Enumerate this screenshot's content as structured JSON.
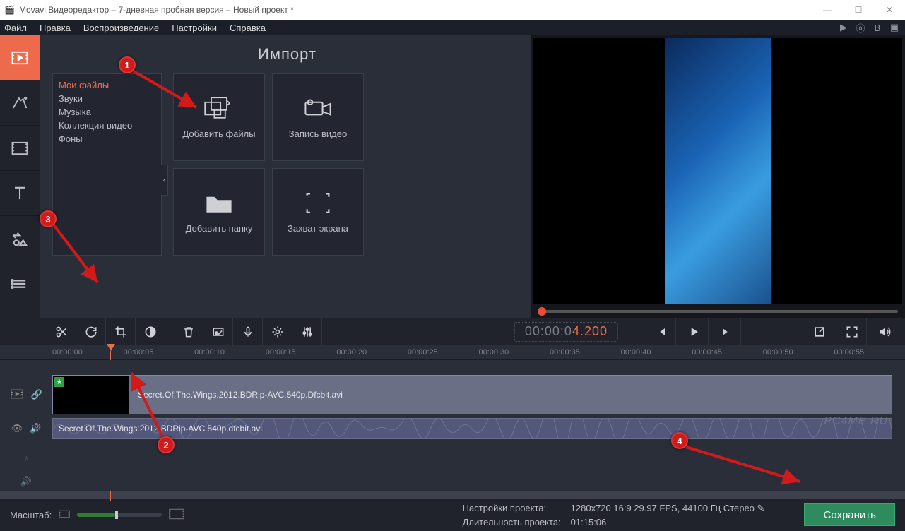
{
  "window": {
    "title": "Movavi Видеоредактор – 7-дневная пробная версия – Новый проект *"
  },
  "menu": {
    "items": [
      "Файл",
      "Правка",
      "Воспроизведение",
      "Настройки",
      "Справка"
    ]
  },
  "import": {
    "title": "Импорт",
    "sources": [
      "Мои файлы",
      "Звуки",
      "Музыка",
      "Коллекция видео",
      "Фоны"
    ],
    "tiles": {
      "add_files": "Добавить файлы",
      "record_video": "Запись видео",
      "add_folder": "Добавить папку",
      "screen_capture": "Захват экрана"
    }
  },
  "playback": {
    "timecode_grey": "00:00:0",
    "timecode_orange": "4.200"
  },
  "ruler": {
    "ticks": [
      "00:00:00",
      "00:00:05",
      "00:00:10",
      "00:00:15",
      "00:00:20",
      "00:00:25",
      "00:00:30",
      "00:00:35",
      "00:00:40",
      "00:00:45",
      "00:00:50",
      "00:00:55"
    ]
  },
  "timeline": {
    "video_clip": "Secret.Of.The.Wings.2012.BDRip-AVC.540p.Dfcbit.avi",
    "audio_clip": "Secret.Of.The.Wings.2012.BDRip-AVC.540p.dfcbit.avi"
  },
  "bottom": {
    "zoom_label": "Масштаб:",
    "settings_label": "Настройки проекта:",
    "settings_value": "1280x720 16:9 29.97 FPS, 44100 Гц Стерео",
    "duration_label": "Длительность проекта:",
    "duration_value": "01:15:06",
    "save": "Сохранить"
  },
  "annotations": {
    "a1": "1",
    "a2": "2",
    "a3": "3",
    "a4": "4"
  },
  "watermark": "PC4ME.RU"
}
